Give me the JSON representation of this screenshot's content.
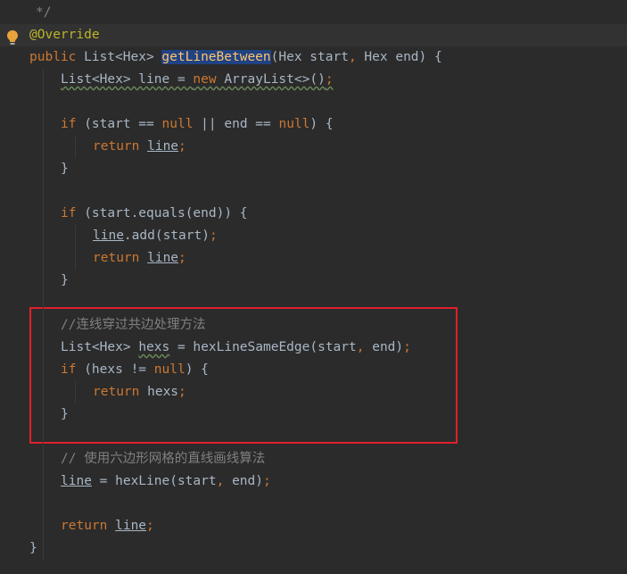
{
  "editor": {
    "lines": [
      {
        "indent": 1,
        "html_segments": [
          {
            "t": "*/",
            "c": "cm"
          }
        ]
      },
      {
        "indent": 1,
        "current": true,
        "segments": [
          {
            "t": "@Override",
            "c": "ann"
          }
        ]
      },
      {
        "indent": 1,
        "segments": [
          {
            "t": "public ",
            "c": "k"
          },
          {
            "t": "List<Hex> ",
            "c": ""
          },
          {
            "t": "getLineBetween",
            "c": "hl"
          },
          {
            "t": "(Hex start",
            "c": ""
          },
          {
            "t": ", ",
            "c": "k"
          },
          {
            "t": "Hex end) {",
            "c": ""
          }
        ]
      },
      {
        "indent": 2,
        "segments": [
          {
            "t": "List<Hex> line = ",
            "c": "warn"
          },
          {
            "t": "new ",
            "c": "k warn"
          },
          {
            "t": "ArrayList<>()",
            "c": "warn"
          },
          {
            "t": ";",
            "c": "k warn"
          }
        ]
      },
      {
        "indent": 0,
        "segments": []
      },
      {
        "indent": 2,
        "segments": [
          {
            "t": "if ",
            "c": "k"
          },
          {
            "t": "(start == ",
            "c": ""
          },
          {
            "t": "null ",
            "c": "k"
          },
          {
            "t": "|| end == ",
            "c": ""
          },
          {
            "t": "null",
            "c": "k"
          },
          {
            "t": ") {",
            "c": ""
          }
        ]
      },
      {
        "indent": 3,
        "segments": [
          {
            "t": "return ",
            "c": "k"
          },
          {
            "t": "line",
            "c": "u"
          },
          {
            "t": ";",
            "c": "k"
          }
        ]
      },
      {
        "indent": 2,
        "segments": [
          {
            "t": "}",
            "c": ""
          }
        ]
      },
      {
        "indent": 0,
        "segments": []
      },
      {
        "indent": 2,
        "segments": [
          {
            "t": "if ",
            "c": "k"
          },
          {
            "t": "(start.equals(end)) {",
            "c": ""
          }
        ]
      },
      {
        "indent": 3,
        "segments": [
          {
            "t": "line",
            "c": "u"
          },
          {
            "t": ".add(start)",
            "c": ""
          },
          {
            "t": ";",
            "c": "k"
          }
        ]
      },
      {
        "indent": 3,
        "segments": [
          {
            "t": "return ",
            "c": "k"
          },
          {
            "t": "line",
            "c": "u"
          },
          {
            "t": ";",
            "c": "k"
          }
        ]
      },
      {
        "indent": 2,
        "segments": [
          {
            "t": "}",
            "c": ""
          }
        ]
      },
      {
        "indent": 0,
        "segments": []
      },
      {
        "indent": 2,
        "segments": [
          {
            "t": "//连线穿过共边处理方法",
            "c": "cm"
          }
        ]
      },
      {
        "indent": 2,
        "segments": [
          {
            "t": "List<Hex> ",
            "c": ""
          },
          {
            "t": "hexs",
            "c": "warn"
          },
          {
            "t": " = hexLineSameEdge(start",
            "c": ""
          },
          {
            "t": ", ",
            "c": "k"
          },
          {
            "t": "end)",
            "c": ""
          },
          {
            "t": ";",
            "c": "k"
          }
        ]
      },
      {
        "indent": 2,
        "segments": [
          {
            "t": "if ",
            "c": "k"
          },
          {
            "t": "(hexs != ",
            "c": ""
          },
          {
            "t": "null",
            "c": "k"
          },
          {
            "t": ") {",
            "c": ""
          }
        ]
      },
      {
        "indent": 3,
        "segments": [
          {
            "t": "return ",
            "c": "k"
          },
          {
            "t": "hexs",
            "c": ""
          },
          {
            "t": ";",
            "c": "k"
          }
        ]
      },
      {
        "indent": 2,
        "segments": [
          {
            "t": "}",
            "c": ""
          }
        ]
      },
      {
        "indent": 0,
        "segments": []
      },
      {
        "indent": 2,
        "segments": [
          {
            "t": "// 使用六边形网格的直线画线算法",
            "c": "cm"
          }
        ]
      },
      {
        "indent": 2,
        "segments": [
          {
            "t": "line",
            "c": "u"
          },
          {
            "t": " = hexLine(start",
            "c": ""
          },
          {
            "t": ", ",
            "c": "k"
          },
          {
            "t": "end)",
            "c": ""
          },
          {
            "t": ";",
            "c": "k"
          }
        ]
      },
      {
        "indent": 0,
        "segments": []
      },
      {
        "indent": 2,
        "segments": [
          {
            "t": "return ",
            "c": "k"
          },
          {
            "t": "line",
            "c": "u"
          },
          {
            "t": ";",
            "c": "k"
          }
        ]
      },
      {
        "indent": 1,
        "segments": [
          {
            "t": "}",
            "c": ""
          }
        ]
      }
    ]
  },
  "colors": {
    "background": "#2b2b2b",
    "keyword": "#cc7832",
    "comment": "#808080",
    "annotation": "#bbb529",
    "highlight_box": "#e0202a"
  },
  "icons": {
    "gutter": "lightbulb-icon"
  }
}
